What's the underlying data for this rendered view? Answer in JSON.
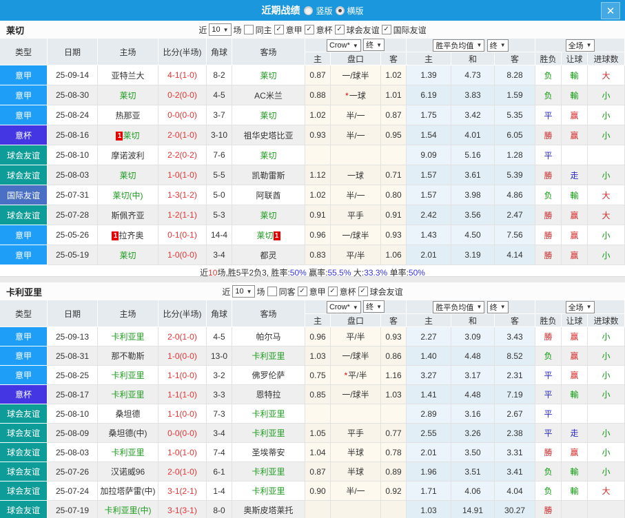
{
  "titlebar": {
    "title": "近期战绩",
    "radio_vertical": "竖版",
    "radio_horizontal": "横版",
    "vertical_selected": false,
    "horizontal_selected": true,
    "close": "✕"
  },
  "league_colors": {
    "yj": {
      "label": "意甲",
      "color": "#1f9ef7"
    },
    "yb": {
      "label": "意杯",
      "color": "#4436e2"
    },
    "qh": {
      "label": "球会友谊",
      "color": "#0d9c98"
    },
    "gj": {
      "label": "国际友谊",
      "color": "#4a70c5"
    }
  },
  "result_colors": {
    "r": "#d42a2a",
    "g": "#0c9c0c",
    "b": "#2929cc"
  },
  "table_headers": {
    "type": "类型",
    "date": "日期",
    "home": "主场",
    "score": "比分(半场)",
    "corner": "角球",
    "away": "客场",
    "dd_crow": "Crow*",
    "dd_final1": "终",
    "dd_avg": "胜平负均值",
    "dd_final2": "终",
    "dd_full": "全场",
    "sub": [
      "主",
      "盘口",
      "客",
      "主",
      "和",
      "客",
      "胜负",
      "让球",
      "进球数"
    ]
  },
  "sections": [
    {
      "team": "莱切",
      "filter": {
        "near": "近",
        "count": "10",
        "games": "场",
        "same": "同主",
        "same_checked": false,
        "leagues": [
          {
            "label": "意甲",
            "checked": true
          },
          {
            "label": "意杯",
            "checked": true
          },
          {
            "label": "球会友谊",
            "checked": true
          },
          {
            "label": "国际友谊",
            "checked": true
          }
        ]
      },
      "rows": [
        {
          "league": "yj",
          "date": "25-09-14",
          "home": {
            "name": "亚特兰大",
            "green": false
          },
          "score": "4-1",
          "half": "(1-0)",
          "corner": "8-2",
          "away": {
            "name": "莱切",
            "green": true
          },
          "odds": [
            "0.87",
            "一/球半",
            "1.02"
          ],
          "star": false,
          "avg": [
            "1.39",
            "4.73",
            "8.28"
          ],
          "results": [
            {
              "t": "负",
              "c": "g"
            },
            {
              "t": "輸",
              "c": "g"
            },
            {
              "t": "大",
              "c": "r"
            }
          ]
        },
        {
          "league": "yj",
          "date": "25-08-30",
          "home": {
            "name": "莱切",
            "green": true
          },
          "score": "0-2",
          "half": "(0-0)",
          "corner": "4-5",
          "away": {
            "name": "AC米兰",
            "green": false
          },
          "odds": [
            "0.88",
            "一球",
            "1.01"
          ],
          "star": true,
          "avg": [
            "6.19",
            "3.83",
            "1.59"
          ],
          "results": [
            {
              "t": "负",
              "c": "g"
            },
            {
              "t": "輸",
              "c": "g"
            },
            {
              "t": "小",
              "c": "g"
            }
          ]
        },
        {
          "league": "yj",
          "date": "25-08-24",
          "home": {
            "name": "热那亚",
            "green": false
          },
          "score": "0-0",
          "half": "(0-0)",
          "corner": "3-7",
          "away": {
            "name": "莱切",
            "green": true
          },
          "odds": [
            "1.02",
            "半/一",
            "0.87"
          ],
          "star": false,
          "avg": [
            "1.75",
            "3.42",
            "5.35"
          ],
          "results": [
            {
              "t": "平",
              "c": "b"
            },
            {
              "t": "赢",
              "c": "r"
            },
            {
              "t": "小",
              "c": "g"
            }
          ]
        },
        {
          "league": "yb",
          "date": "25-08-16",
          "home": {
            "name": "莱切",
            "green": true,
            "card_before": "1"
          },
          "score": "2-0",
          "half": "(1-0)",
          "corner": "3-10",
          "away": {
            "name": "祖华史塔比亚",
            "green": false
          },
          "odds": [
            "0.93",
            "半/一",
            "0.95"
          ],
          "star": false,
          "avg": [
            "1.54",
            "4.01",
            "6.05"
          ],
          "results": [
            {
              "t": "勝",
              "c": "r"
            },
            {
              "t": "赢",
              "c": "r"
            },
            {
              "t": "小",
              "c": "g"
            }
          ]
        },
        {
          "league": "qh",
          "date": "25-08-10",
          "home": {
            "name": "摩诺波利",
            "green": false
          },
          "score": "2-2",
          "half": "(0-2)",
          "corner": "7-6",
          "away": {
            "name": "莱切",
            "green": true
          },
          "odds": [
            "",
            "",
            ""
          ],
          "star": false,
          "avg": [
            "9.09",
            "5.16",
            "1.28"
          ],
          "results": [
            {
              "t": "平",
              "c": "b"
            },
            {
              "t": "",
              "c": "b"
            },
            {
              "t": "",
              "c": "b"
            }
          ]
        },
        {
          "league": "qh",
          "date": "25-08-03",
          "home": {
            "name": "莱切",
            "green": true
          },
          "score": "1-0",
          "half": "(1-0)",
          "corner": "5-5",
          "away": {
            "name": "凯勒雷斯",
            "green": false
          },
          "odds": [
            "1.12",
            "一球",
            "0.71"
          ],
          "star": false,
          "avg": [
            "1.57",
            "3.61",
            "5.39"
          ],
          "results": [
            {
              "t": "勝",
              "c": "r"
            },
            {
              "t": "走",
              "c": "b"
            },
            {
              "t": "小",
              "c": "g"
            }
          ]
        },
        {
          "league": "gj",
          "date": "25-07-31",
          "home": {
            "name": "莱切(中)",
            "green": true
          },
          "score": "1-3",
          "half": "(1-2)",
          "corner": "5-0",
          "away": {
            "name": "阿联酋",
            "green": false
          },
          "odds": [
            "1.02",
            "半/一",
            "0.80"
          ],
          "star": false,
          "avg": [
            "1.57",
            "3.98",
            "4.86"
          ],
          "results": [
            {
              "t": "负",
              "c": "g"
            },
            {
              "t": "輸",
              "c": "g"
            },
            {
              "t": "大",
              "c": "r"
            }
          ]
        },
        {
          "league": "qh",
          "date": "25-07-28",
          "home": {
            "name": "斯佩齐亚",
            "green": false
          },
          "score": "1-2",
          "half": "(1-1)",
          "corner": "5-3",
          "away": {
            "name": "莱切",
            "green": true
          },
          "odds": [
            "0.91",
            "平手",
            "0.91"
          ],
          "star": false,
          "avg": [
            "2.42",
            "3.56",
            "2.47"
          ],
          "results": [
            {
              "t": "勝",
              "c": "r"
            },
            {
              "t": "赢",
              "c": "r"
            },
            {
              "t": "大",
              "c": "r"
            }
          ]
        },
        {
          "league": "yj",
          "date": "25-05-26",
          "home": {
            "name": "拉齐奥",
            "green": false,
            "card_before": "1"
          },
          "score": "0-1",
          "half": "(0-1)",
          "corner": "14-4",
          "away": {
            "name": "莱切",
            "green": true,
            "card_after": "1"
          },
          "odds": [
            "0.96",
            "一/球半",
            "0.93"
          ],
          "star": false,
          "avg": [
            "1.43",
            "4.50",
            "7.56"
          ],
          "results": [
            {
              "t": "勝",
              "c": "r"
            },
            {
              "t": "赢",
              "c": "r"
            },
            {
              "t": "小",
              "c": "g"
            }
          ]
        },
        {
          "league": "yj",
          "date": "25-05-19",
          "home": {
            "name": "莱切",
            "green": true
          },
          "score": "1-0",
          "half": "(0-0)",
          "corner": "3-4",
          "away": {
            "name": "都灵",
            "green": false
          },
          "odds": [
            "0.83",
            "平/半",
            "1.06"
          ],
          "star": false,
          "avg": [
            "2.01",
            "3.19",
            "4.14"
          ],
          "results": [
            {
              "t": "勝",
              "c": "r"
            },
            {
              "t": "赢",
              "c": "r"
            },
            {
              "t": "小",
              "c": "g"
            }
          ]
        }
      ],
      "summary": [
        {
          "t": "近",
          "c": "k"
        },
        {
          "t": "10",
          "c": "n"
        },
        {
          "t": "场,胜5平2负3, 胜率:",
          "c": "k"
        },
        {
          "t": "50%",
          "c": "v"
        },
        {
          "t": " 赢率:",
          "c": "k"
        },
        {
          "t": "55.5%",
          "c": "v"
        },
        {
          "t": " 大:",
          "c": "k"
        },
        {
          "t": "33.3%",
          "c": "v"
        },
        {
          "t": " 单率:",
          "c": "k"
        },
        {
          "t": "50%",
          "c": "v"
        }
      ]
    },
    {
      "team": "卡利亚里",
      "filter": {
        "near": "近",
        "count": "10",
        "games": "场",
        "same": "同客",
        "same_checked": false,
        "leagues": [
          {
            "label": "意甲",
            "checked": true
          },
          {
            "label": "意杯",
            "checked": true
          },
          {
            "label": "球会友谊",
            "checked": true
          }
        ]
      },
      "rows": [
        {
          "league": "yj",
          "date": "25-09-13",
          "home": {
            "name": "卡利亚里",
            "green": true
          },
          "score": "2-0",
          "half": "(1-0)",
          "corner": "4-5",
          "away": {
            "name": "帕尔马",
            "green": false
          },
          "odds": [
            "0.96",
            "平/半",
            "0.93"
          ],
          "star": false,
          "avg": [
            "2.27",
            "3.09",
            "3.43"
          ],
          "results": [
            {
              "t": "勝",
              "c": "r"
            },
            {
              "t": "赢",
              "c": "r"
            },
            {
              "t": "小",
              "c": "g"
            }
          ]
        },
        {
          "league": "yj",
          "date": "25-08-31",
          "home": {
            "name": "那不勒斯",
            "green": false
          },
          "score": "1-0",
          "half": "(0-0)",
          "corner": "13-0",
          "away": {
            "name": "卡利亚里",
            "green": true
          },
          "odds": [
            "1.03",
            "一/球半",
            "0.86"
          ],
          "star": false,
          "avg": [
            "1.40",
            "4.48",
            "8.52"
          ],
          "results": [
            {
              "t": "负",
              "c": "g"
            },
            {
              "t": "赢",
              "c": "r"
            },
            {
              "t": "小",
              "c": "g"
            }
          ]
        },
        {
          "league": "yj",
          "date": "25-08-25",
          "home": {
            "name": "卡利亚里",
            "green": true
          },
          "score": "1-1",
          "half": "(0-0)",
          "corner": "3-2",
          "away": {
            "name": "佛罗伦萨",
            "green": false
          },
          "odds": [
            "0.75",
            "平/半",
            "1.16"
          ],
          "star": true,
          "avg": [
            "3.27",
            "3.17",
            "2.31"
          ],
          "results": [
            {
              "t": "平",
              "c": "b"
            },
            {
              "t": "赢",
              "c": "r"
            },
            {
              "t": "小",
              "c": "g"
            }
          ]
        },
        {
          "league": "yb",
          "date": "25-08-17",
          "home": {
            "name": "卡利亚里",
            "green": true
          },
          "score": "1-1",
          "half": "(1-0)",
          "corner": "3-3",
          "away": {
            "name": "恩特拉",
            "green": false
          },
          "odds": [
            "0.85",
            "一/球半",
            "1.03"
          ],
          "star": false,
          "avg": [
            "1.41",
            "4.48",
            "7.19"
          ],
          "results": [
            {
              "t": "平",
              "c": "b"
            },
            {
              "t": "輸",
              "c": "g"
            },
            {
              "t": "小",
              "c": "g"
            }
          ]
        },
        {
          "league": "qh",
          "date": "25-08-10",
          "home": {
            "name": "桑坦德",
            "green": false
          },
          "score": "1-1",
          "half": "(0-0)",
          "corner": "7-3",
          "away": {
            "name": "卡利亚里",
            "green": true
          },
          "odds": [
            "",
            "",
            ""
          ],
          "star": false,
          "avg": [
            "2.89",
            "3.16",
            "2.67"
          ],
          "results": [
            {
              "t": "平",
              "c": "b"
            },
            {
              "t": "",
              "c": "b"
            },
            {
              "t": "",
              "c": "b"
            }
          ]
        },
        {
          "league": "qh",
          "date": "25-08-09",
          "home": {
            "name": "桑坦德(中)",
            "green": false
          },
          "score": "0-0",
          "half": "(0-0)",
          "corner": "3-4",
          "away": {
            "name": "卡利亚里",
            "green": true
          },
          "odds": [
            "1.05",
            "平手",
            "0.77"
          ],
          "star": false,
          "avg": [
            "2.55",
            "3.26",
            "2.38"
          ],
          "results": [
            {
              "t": "平",
              "c": "b"
            },
            {
              "t": "走",
              "c": "b"
            },
            {
              "t": "小",
              "c": "g"
            }
          ]
        },
        {
          "league": "qh",
          "date": "25-08-03",
          "home": {
            "name": "卡利亚里",
            "green": true
          },
          "score": "1-0",
          "half": "(1-0)",
          "corner": "7-4",
          "away": {
            "name": "圣埃蒂安",
            "green": false
          },
          "odds": [
            "1.04",
            "半球",
            "0.78"
          ],
          "star": false,
          "avg": [
            "2.01",
            "3.50",
            "3.31"
          ],
          "results": [
            {
              "t": "勝",
              "c": "r"
            },
            {
              "t": "赢",
              "c": "r"
            },
            {
              "t": "小",
              "c": "g"
            }
          ]
        },
        {
          "league": "qh",
          "date": "25-07-26",
          "home": {
            "name": "汉诺威96",
            "green": false
          },
          "score": "2-0",
          "half": "(1-0)",
          "corner": "6-1",
          "away": {
            "name": "卡利亚里",
            "green": true
          },
          "odds": [
            "0.87",
            "半球",
            "0.89"
          ],
          "star": false,
          "avg": [
            "1.96",
            "3.51",
            "3.41"
          ],
          "results": [
            {
              "t": "负",
              "c": "g"
            },
            {
              "t": "輸",
              "c": "g"
            },
            {
              "t": "小",
              "c": "g"
            }
          ]
        },
        {
          "league": "qh",
          "date": "25-07-24",
          "home": {
            "name": "加拉塔萨雷(中)",
            "green": false
          },
          "score": "3-1",
          "half": "(2-1)",
          "corner": "1-4",
          "away": {
            "name": "卡利亚里",
            "green": true
          },
          "odds": [
            "0.90",
            "半/一",
            "0.92"
          ],
          "star": false,
          "avg": [
            "1.71",
            "4.06",
            "4.04"
          ],
          "results": [
            {
              "t": "负",
              "c": "g"
            },
            {
              "t": "輸",
              "c": "g"
            },
            {
              "t": "大",
              "c": "r"
            }
          ]
        },
        {
          "league": "qh",
          "date": "25-07-19",
          "home": {
            "name": "卡利亚里(中)",
            "green": true
          },
          "score": "3-1",
          "half": "(3-1)",
          "corner": "8-0",
          "away": {
            "name": "奥斯皮塔莱托",
            "green": false
          },
          "odds": [
            "",
            "",
            ""
          ],
          "star": false,
          "avg": [
            "1.03",
            "14.91",
            "30.27"
          ],
          "results": [
            {
              "t": "勝",
              "c": "r"
            },
            {
              "t": "",
              "c": "b"
            },
            {
              "t": "",
              "c": "b"
            }
          ]
        }
      ],
      "summary": null
    }
  ]
}
